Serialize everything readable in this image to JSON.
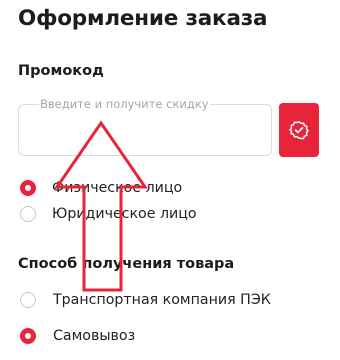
{
  "page_title": "Оформление заказа",
  "promo": {
    "label": "Промокод",
    "placeholder": "Введите и получите скидку",
    "value": "",
    "button_icon": "badge-check-icon",
    "accent": "#e8243b"
  },
  "customer_type": {
    "options": [
      {
        "label": "Физическое лицо",
        "selected": true
      },
      {
        "label": "Юридическое лицо",
        "selected": false
      }
    ]
  },
  "delivery": {
    "label": "Способ получения товара",
    "options": [
      {
        "label": "Транспортная компания ПЭК",
        "selected": false
      },
      {
        "label": "Самовывоз",
        "selected": true
      }
    ]
  },
  "overlay": {
    "icon": "up-arrow-annotation-icon",
    "color": "#e8243b"
  }
}
